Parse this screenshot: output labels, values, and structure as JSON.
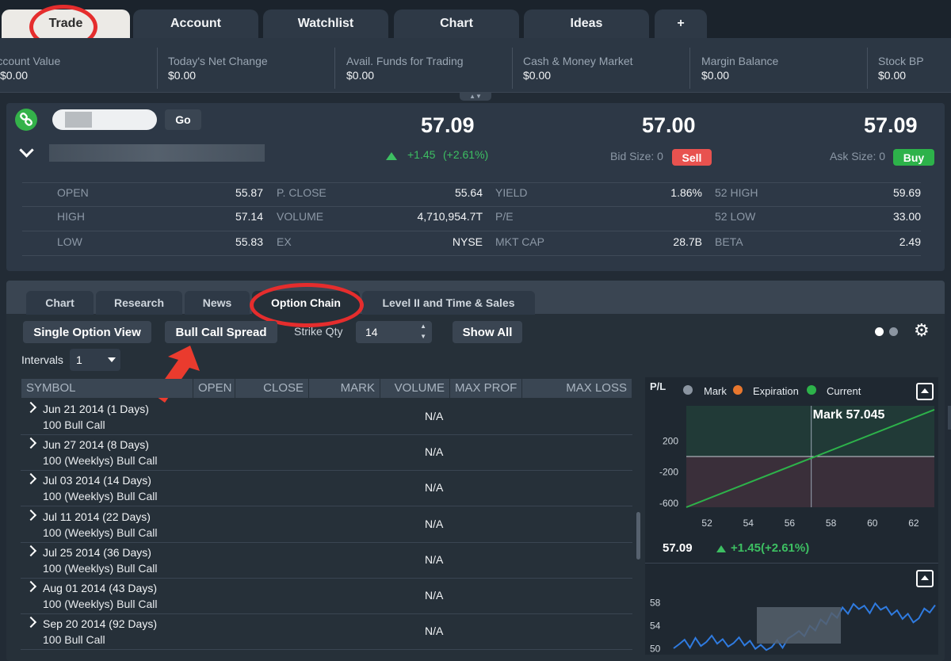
{
  "top_tabs": [
    "Trade",
    "Account",
    "Watchlist",
    "Chart",
    "Ideas",
    "+"
  ],
  "summary": [
    {
      "label": "Account Value",
      "value": "$0.00"
    },
    {
      "label": "Today's Net Change",
      "value": "$0.00"
    },
    {
      "label": "Avail. Funds for Trading",
      "value": "$0.00"
    },
    {
      "label": "Cash & Money Market",
      "value": "$0.00"
    },
    {
      "label": "Margin Balance",
      "value": "$0.00"
    },
    {
      "label": "Stock BP",
      "value": "$0.00"
    }
  ],
  "quote": {
    "go_label": "Go",
    "last": "57.09",
    "change": "+1.45",
    "change_pct": "(+2.61%)",
    "bid": "57.00",
    "bid_size": "Bid Size: 0",
    "sell_label": "Sell",
    "ask": "57.09",
    "ask_size": "Ask Size: 0",
    "buy_label": "Buy",
    "colors": {
      "up": "#3dbf62",
      "sell": "#e8524f",
      "buy": "#2db24a"
    }
  },
  "stats": [
    [
      {
        "k": "OPEN",
        "v": "55.87"
      },
      {
        "k": "P. CLOSE",
        "v": "55.64"
      },
      {
        "k": "YIELD",
        "v": "1.86%"
      },
      {
        "k": "52 HIGH",
        "v": "59.69"
      }
    ],
    [
      {
        "k": "HIGH",
        "v": "57.14"
      },
      {
        "k": "VOLUME",
        "v": "4,710,954.7T"
      },
      {
        "k": "P/E",
        "v": ""
      },
      {
        "k": "52 LOW",
        "v": "33.00"
      }
    ],
    [
      {
        "k": "LOW",
        "v": "55.83"
      },
      {
        "k": "EX",
        "v": "NYSE"
      },
      {
        "k": "MKT CAP",
        "v": "28.7B"
      },
      {
        "k": "BETA",
        "v": "2.49"
      }
    ]
  ],
  "sub_tabs": [
    "Chart",
    "Research",
    "News",
    "Option Chain",
    "Level II and Time & Sales"
  ],
  "toolbar": {
    "single_option": "Single Option View",
    "strategy": "Bull Call Spread",
    "strike_qty_label": "Strike Qty",
    "strike_qty_value": "14",
    "show_all": "Show All",
    "intervals_label": "Intervals",
    "intervals_value": "1"
  },
  "columns": [
    "SYMBOL",
    "OPEN",
    "CLOSE",
    "MARK",
    "VOLUME",
    "MAX PROF",
    "MAX LOSS"
  ],
  "rows": [
    {
      "date": "Jun 21 2014 (1 Days)",
      "desc": "100 Bull Call",
      "value": "N/A"
    },
    {
      "date": "Jun 27 2014 (8 Days)",
      "desc": "100 (Weeklys) Bull Call",
      "value": "N/A"
    },
    {
      "date": "Jul 03 2014 (14 Days)",
      "desc": "100 (Weeklys) Bull Call",
      "value": "N/A"
    },
    {
      "date": "Jul 11 2014 (22 Days)",
      "desc": "100 (Weeklys) Bull Call",
      "value": "N/A"
    },
    {
      "date": "Jul 25 2014 (36 Days)",
      "desc": "100 (Weeklys) Bull Call",
      "value": "N/A"
    },
    {
      "date": "Aug 01 2014 (43 Days)",
      "desc": "100 (Weeklys) Bull Call",
      "value": "N/A"
    },
    {
      "date": "Sep 20 2014 (92 Days)",
      "desc": "100 Bull Call",
      "value": "N/A"
    }
  ],
  "pl_chart": {
    "header": "P/L",
    "legend": [
      {
        "name": "Mark",
        "color": "#e8772e"
      },
      {
        "name": "Expiration",
        "color": "#2db24a"
      },
      {
        "name": "Current",
        "color": ""
      }
    ],
    "mark_label": "Mark 57.045",
    "y_ticks": [
      "200",
      "-200",
      "-600"
    ],
    "x_ticks": [
      "52",
      "54",
      "56",
      "58",
      "60",
      "62"
    ],
    "x_range": [
      51,
      63
    ],
    "y_range": [
      -650,
      650
    ],
    "mark_x": 57.045,
    "series_expiration": [
      {
        "x": 51,
        "y": -650
      },
      {
        "x": 63,
        "y": 600
      }
    ]
  },
  "mini_quote": {
    "last": "57.09",
    "change": "+1.45(+2.61%)"
  },
  "price_chart": {
    "y_ticks": [
      "58",
      "54",
      "50"
    ],
    "y_range": [
      49,
      60
    ],
    "values": [
      50.1,
      50.8,
      51.6,
      50.2,
      51.9,
      50.5,
      51.2,
      52.3,
      50.9,
      51.7,
      50.4,
      51.0,
      52.0,
      50.6,
      51.4,
      50.0,
      50.7,
      49.8,
      50.3,
      51.5,
      50.2,
      51.8,
      52.4,
      53.1,
      52.2,
      54.0,
      53.2,
      55.1,
      54.3,
      56.2,
      55.4,
      57.2,
      56.1,
      57.8,
      56.9,
      57.5,
      56.2,
      57.9,
      56.8,
      57.3,
      55.9,
      56.7,
      55.2,
      56.1,
      54.6,
      55.3,
      57.0,
      56.3,
      57.6
    ]
  }
}
